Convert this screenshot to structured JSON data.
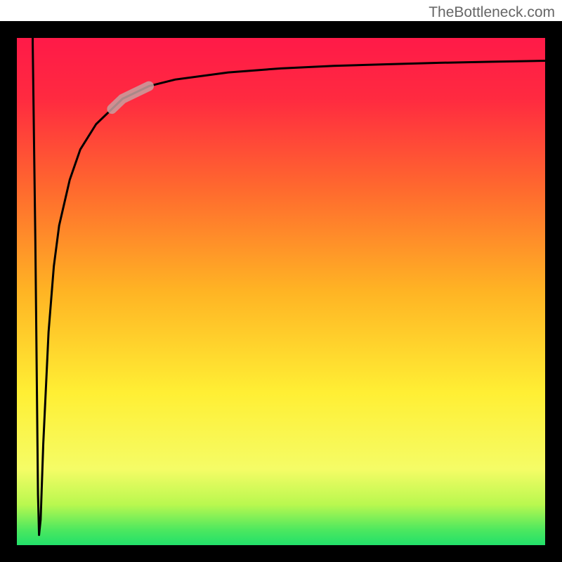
{
  "attribution": "TheBottleneck.com",
  "chart_data": {
    "type": "line",
    "title": "",
    "xlabel": "",
    "ylabel": "",
    "xlim": [
      0,
      100
    ],
    "ylim": [
      0,
      100
    ],
    "series": [
      {
        "name": "curve",
        "x": [
          3.0,
          3.5,
          3.8,
          4.0,
          4.2,
          4.5,
          5,
          6,
          7,
          8,
          10,
          12,
          15,
          18,
          20,
          25,
          30,
          40,
          50,
          60,
          70,
          80,
          90,
          100
        ],
        "values": [
          99,
          60,
          30,
          10,
          2,
          5,
          20,
          42,
          55,
          63,
          72,
          78,
          83,
          86,
          88,
          90.5,
          91.8,
          93.2,
          94,
          94.5,
          94.8,
          95.1,
          95.3,
          95.5
        ]
      }
    ],
    "highlight_segment": {
      "x_start": 18,
      "x_end": 25
    },
    "gradient_stops": [
      {
        "offset": 0,
        "color": "#22e06a"
      },
      {
        "offset": 3,
        "color": "#4ce85f"
      },
      {
        "offset": 8,
        "color": "#b9f84f"
      },
      {
        "offset": 15,
        "color": "#f5fc66"
      },
      {
        "offset": 30,
        "color": "#ffef34"
      },
      {
        "offset": 50,
        "color": "#ffb424"
      },
      {
        "offset": 70,
        "color": "#ff6a2e"
      },
      {
        "offset": 88,
        "color": "#ff2a40"
      },
      {
        "offset": 100,
        "color": "#ff1a48"
      }
    ],
    "border_width": 24,
    "plot_padding_top": 30
  }
}
